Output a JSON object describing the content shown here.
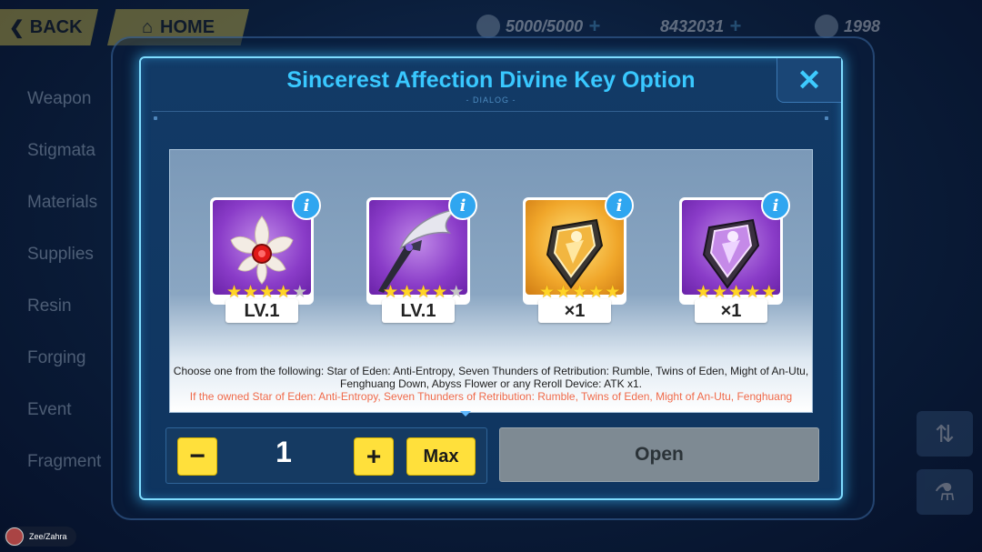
{
  "background": {
    "back_label": "BACK",
    "home_label": "HOME",
    "stamina": "5000/5000",
    "coins": "8432031",
    "crystals": "1998",
    "side_menu": [
      "Weapon",
      "Stigmata",
      "Materials",
      "Supplies",
      "Resin",
      "Forging",
      "Event",
      "Fragment"
    ]
  },
  "dialog": {
    "title": "Sincerest Affection Divine Key Option",
    "subtitle": "- DIALOG -",
    "close_icon": "close-x-icon",
    "items": [
      {
        "name": "lotus-weapon",
        "icon": "lotus-flower-icon",
        "label": "LV.1",
        "stars": 4,
        "max_stars": 5,
        "bg": "purple"
      },
      {
        "name": "scythe-weapon",
        "icon": "scythe-icon",
        "label": "LV.1",
        "stars": 4,
        "max_stars": 5,
        "bg": "purple"
      },
      {
        "name": "reroll-device-gold",
        "icon": "reroll-device-icon",
        "label": "×1",
        "stars": 5,
        "max_stars": 5,
        "bg": "gold"
      },
      {
        "name": "reroll-device-purple",
        "icon": "reroll-device-icon",
        "label": "×1",
        "stars": 5,
        "max_stars": 5,
        "bg": "purple"
      }
    ],
    "description": "Choose one from the following: Star of Eden: Anti-Entropy, Seven Thunders of Retribution: Rumble, Twins of Eden, Might of An-Utu, Fenghuang Down, Abyss Flower or any Reroll Device: ATK x1.",
    "warning": "If the owned Star of Eden: Anti-Entropy, Seven Thunders of Retribution: Rumble, Twins of Eden, Might of An-Utu, Fenghuang",
    "quantity": "1",
    "minus_label": "−",
    "plus_label": "+",
    "max_label": "Max",
    "open_label": "Open"
  },
  "footer": {
    "user_tag": "Zee/Zahra"
  },
  "colors": {
    "accent_cyan": "#39c8ff",
    "button_yellow": "#ffe03b",
    "warning_orange": "#f06a4a",
    "disabled_grey": "#7e8a93"
  }
}
